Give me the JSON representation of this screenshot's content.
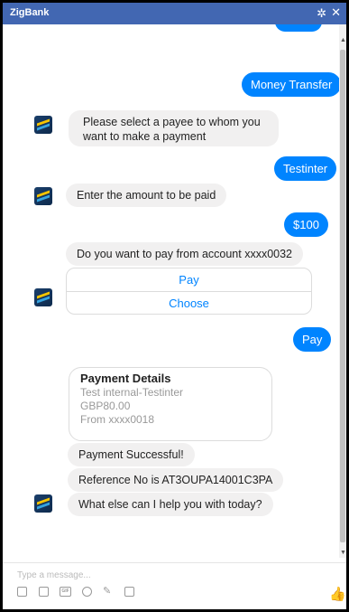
{
  "window": {
    "title": "ZigBank"
  },
  "composer": {
    "placeholder": "Type a message...",
    "gif_label": "GIF"
  },
  "messages": {
    "money_transfer": "Money Transfer",
    "select_payee": "Please select a payee to whom you want to make a payment",
    "testinter": "Testinter",
    "enter_amount": "Enter the amount to be paid",
    "amount": "$100",
    "pay_from": "Do you want to pay from account xxxx0032",
    "pay_reply": "Pay",
    "payment_successful": "Payment Successful!",
    "reference": "Reference No is AT3OUPA14001C3PA",
    "help_more": "What else can I help you with today?"
  },
  "quick_replies": {
    "pay": "Pay",
    "choose": "Choose"
  },
  "payment_details": {
    "title": "Payment Details",
    "payee": "Test internal-Testinter",
    "amount": "GBP80.00",
    "from": "From xxxx0018"
  },
  "colors": {
    "titlebar": "#4267b2",
    "outgoing": "#0084ff",
    "incoming": "#f1f0f0"
  }
}
